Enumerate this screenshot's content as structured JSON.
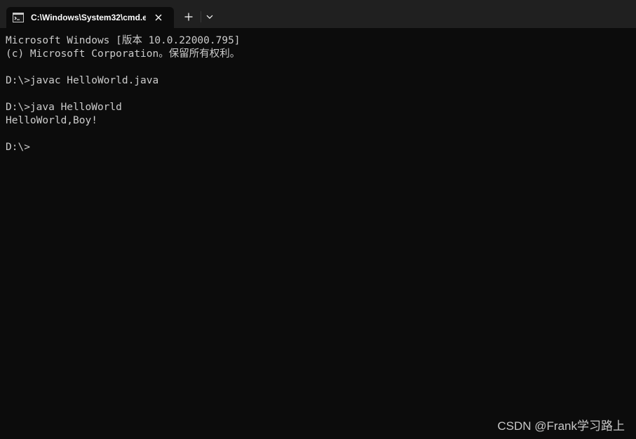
{
  "tab": {
    "title": "C:\\Windows\\System32\\cmd.e",
    "icon": "cmd-icon",
    "close_icon": "close-icon"
  },
  "toolbar": {
    "new_tab_icon": "plus-icon",
    "dropdown_icon": "chevron-down-icon"
  },
  "terminal": {
    "lines": [
      "Microsoft Windows [版本 10.0.22000.795]",
      "(c) Microsoft Corporation。保留所有权利。",
      "",
      "D:\\>javac HelloWorld.java",
      "",
      "D:\\>java HelloWorld",
      "HelloWorld,Boy!",
      "",
      "D:\\>"
    ]
  },
  "watermark": "CSDN @Frank学习路上",
  "colors": {
    "terminal_bg": "#0c0c0c",
    "tabbar_bg": "#202020",
    "text": "#cccccc"
  }
}
